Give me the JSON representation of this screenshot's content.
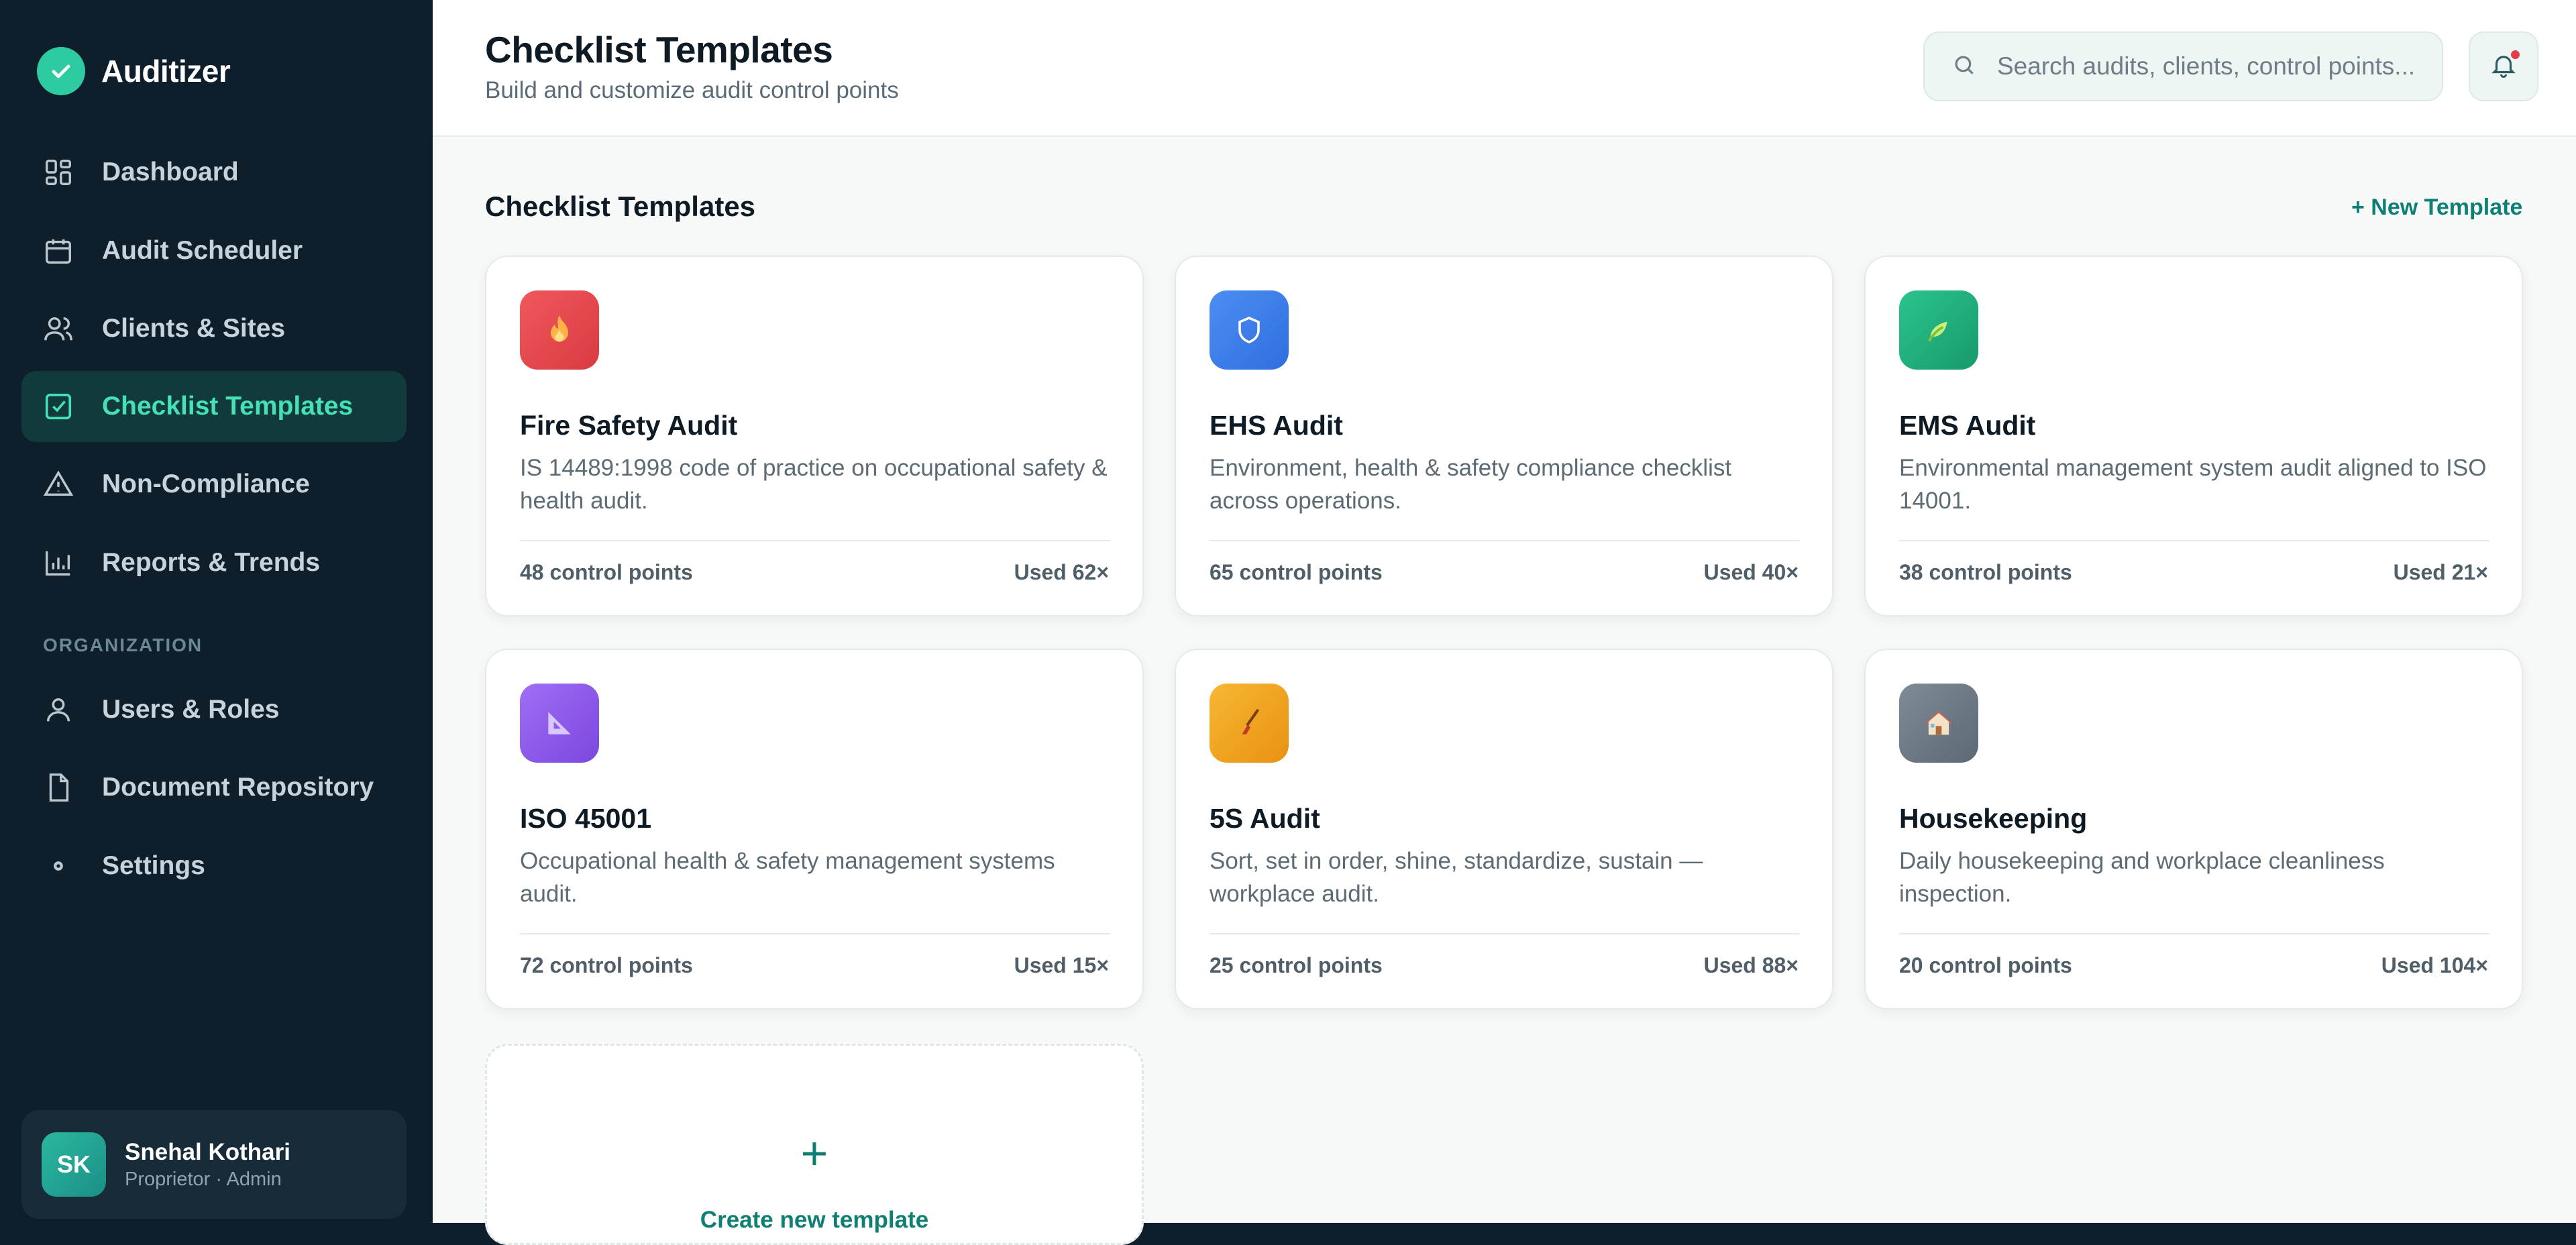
{
  "app": {
    "name": "Auditizer"
  },
  "nav": {
    "items": [
      {
        "label": "Dashboard",
        "icon": "dashboard-grid-icon"
      },
      {
        "label": "Audit Scheduler",
        "icon": "calendar-icon"
      },
      {
        "label": "Clients & Sites",
        "icon": "users-icon"
      },
      {
        "label": "Checklist Templates",
        "icon": "checklist-icon",
        "active": true
      },
      {
        "label": "Non-Compliance",
        "icon": "warning-triangle-icon"
      },
      {
        "label": "Reports & Trends",
        "icon": "bar-chart-icon"
      }
    ],
    "section_label": "ORGANIZATION",
    "org_items": [
      {
        "label": "Users & Roles",
        "icon": "user-icon"
      },
      {
        "label": "Document Repository",
        "icon": "document-icon"
      },
      {
        "label": "Settings",
        "icon": "settings-icon"
      }
    ]
  },
  "user": {
    "initials": "SK",
    "name": "Snehal Kothari",
    "role": "Proprietor · Admin"
  },
  "header": {
    "title": "Checklist Templates",
    "subtitle": "Build and customize audit control points",
    "search_placeholder": "Search audits, clients, control points..."
  },
  "main": {
    "section_title": "Checklist Templates",
    "new_template_label": "+ New Template",
    "templates": [
      {
        "title": "Fire Safety Audit",
        "desc": "IS 14489:1998 code of practice on occupational safety & health audit.",
        "control_points": "48 control points",
        "used": "Used 62×",
        "icon": "flame-icon",
        "color": "#e8474c"
      },
      {
        "title": "EHS Audit",
        "desc": "Environment, health & safety compliance checklist across operations.",
        "control_points": "65 control points",
        "used": "Used 40×",
        "icon": "shield-icon",
        "color": "#3f7ee8"
      },
      {
        "title": "EMS Audit",
        "desc": "Environmental management system audit aligned to ISO 14001.",
        "control_points": "38 control points",
        "used": "Used 21×",
        "icon": "leaf-icon",
        "color": "#1fb07d"
      },
      {
        "title": "ISO 45001",
        "desc": "Occupational health & safety management systems audit.",
        "control_points": "72 control points",
        "used": "Used 15×",
        "icon": "set-square-icon",
        "color": "#8e5ced"
      },
      {
        "title": "5S Audit",
        "desc": "Sort, set in order, shine, standardize, sustain — workplace audit.",
        "control_points": "25 control points",
        "used": "Used 88×",
        "icon": "broom-icon",
        "color": "#f0a21e"
      },
      {
        "title": "Housekeeping",
        "desc": "Daily housekeeping and workplace cleanliness inspection.",
        "control_points": "20 control points",
        "used": "Used 104×",
        "icon": "house-icon",
        "color": "#6d7986"
      }
    ],
    "create_label": "Create new template",
    "create_plus": "+"
  },
  "colors": {
    "accent": "#0f7f74",
    "sidebar": "#0e1f2b",
    "active_text": "#45e0b4",
    "notification_dot": "#e6394a"
  }
}
